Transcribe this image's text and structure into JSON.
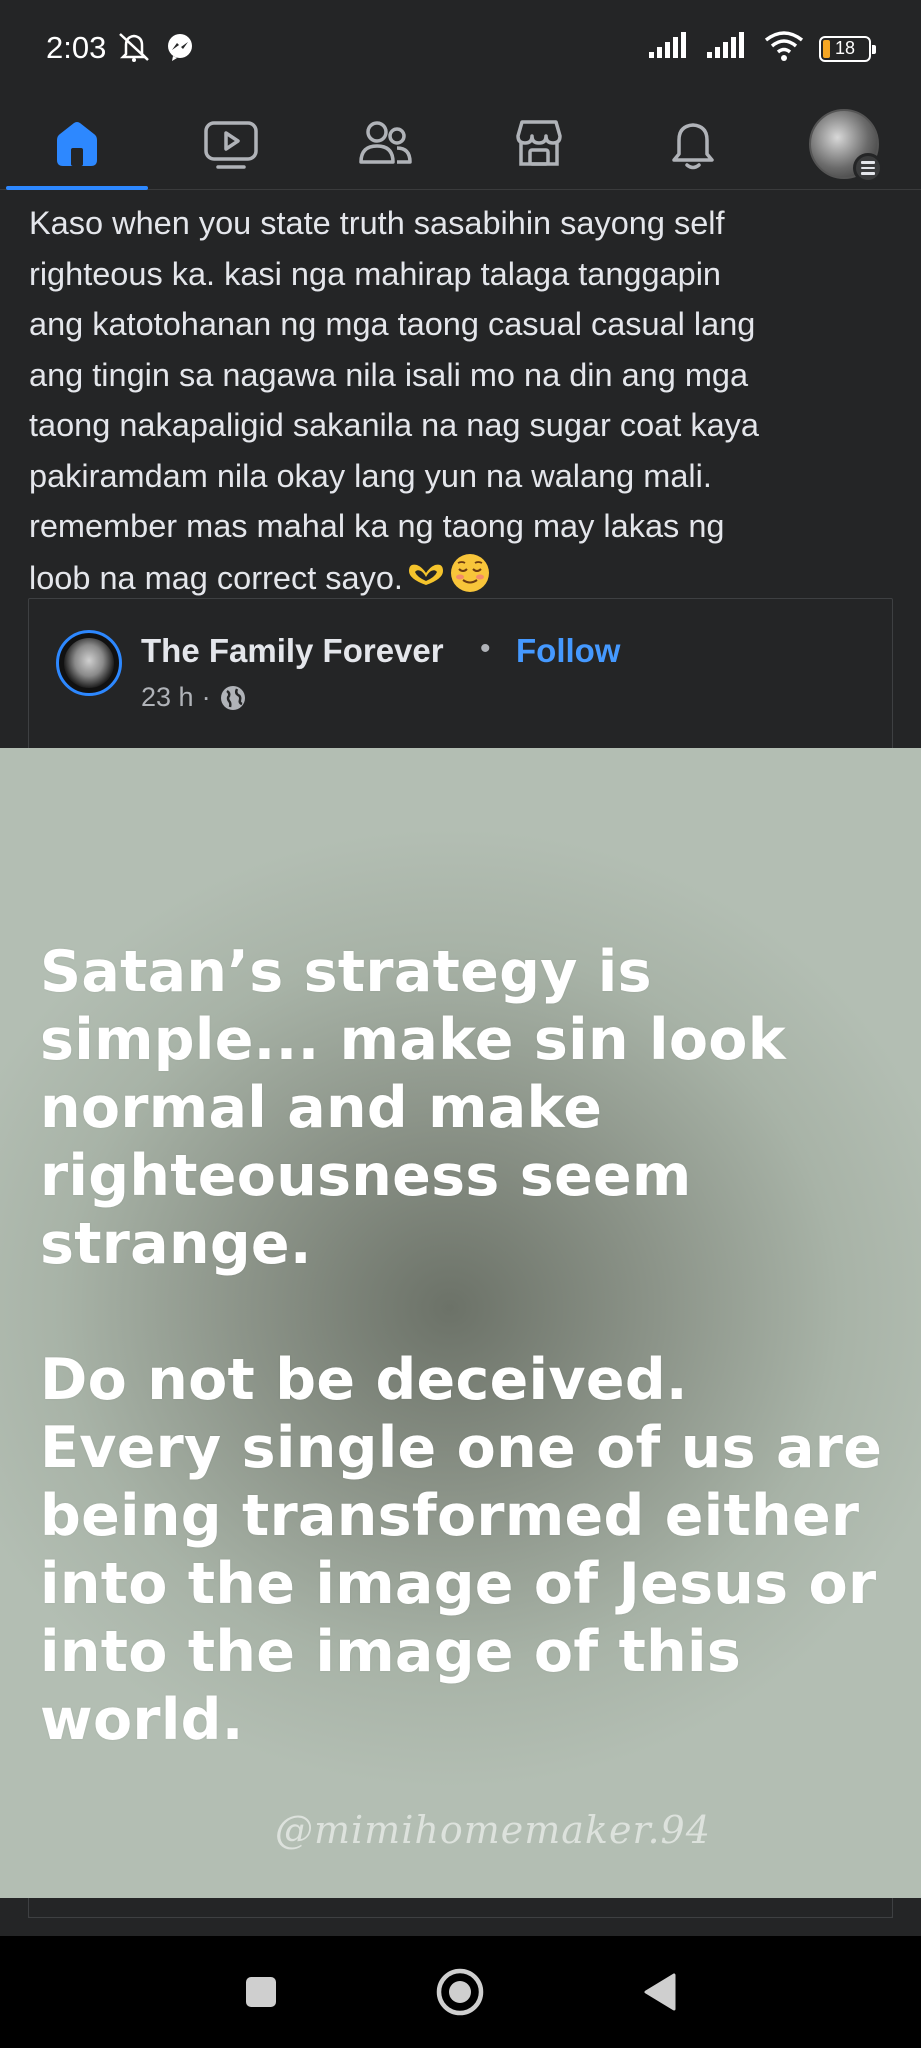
{
  "status_bar": {
    "time": "2:03",
    "icons_left": [
      "alarm-off-icon",
      "messenger-icon"
    ],
    "icons_right": [
      "signal-icon",
      "signal-icon",
      "wifi-icon"
    ],
    "battery_level": "18"
  },
  "nav": {
    "items": [
      {
        "name": "home",
        "icon": "home-icon",
        "active": true
      },
      {
        "name": "video",
        "icon": "video-icon",
        "active": false
      },
      {
        "name": "friends",
        "icon": "friends-icon",
        "active": false
      },
      {
        "name": "marketplace",
        "icon": "marketplace-icon",
        "active": false
      },
      {
        "name": "notifications",
        "icon": "bell-icon",
        "active": false
      },
      {
        "name": "menu",
        "icon": "profile-avatar",
        "active": false
      }
    ],
    "accent_color": "#2d88ff"
  },
  "post": {
    "text_lines": [
      "Kaso when you state truth sasabihin sayong self",
      "righteous ka. kasi nga mahirap talaga tanggapin",
      "ang katotohanan ng mga taong casual casual lang",
      "ang tingin sa nagawa nila isali mo na din ang mga",
      "taong nakapaligid sakanila na nag sugar coat kaya",
      "pakiramdam nila okay lang yun na walang mali.",
      "remember mas mahal ka ng taong may lakas ng",
      "loob na mag correct sayo."
    ],
    "emojis": [
      "heart-hands-emoji",
      "relieved-face-emoji"
    ]
  },
  "shared": {
    "page_name": "The Family Forever",
    "separator": "•",
    "follow_label": "Follow",
    "time": "23 h",
    "meta_separator": "·",
    "privacy_icon": "globe-icon",
    "image": {
      "quote_paragraph_1": [
        "Satan’s strategy is",
        "simple... make sin look",
        "normal and make",
        "righteousness seem",
        "strange."
      ],
      "quote_paragraph_2": [
        "Do not be deceived.",
        "Every single one of us are",
        "being transformed either",
        "into the image of Jesus or",
        "into the image of this",
        "world."
      ],
      "watermark": "@mimihomemaker.94"
    }
  },
  "system_nav": {
    "buttons": [
      "recents-button",
      "home-button",
      "back-button"
    ]
  }
}
